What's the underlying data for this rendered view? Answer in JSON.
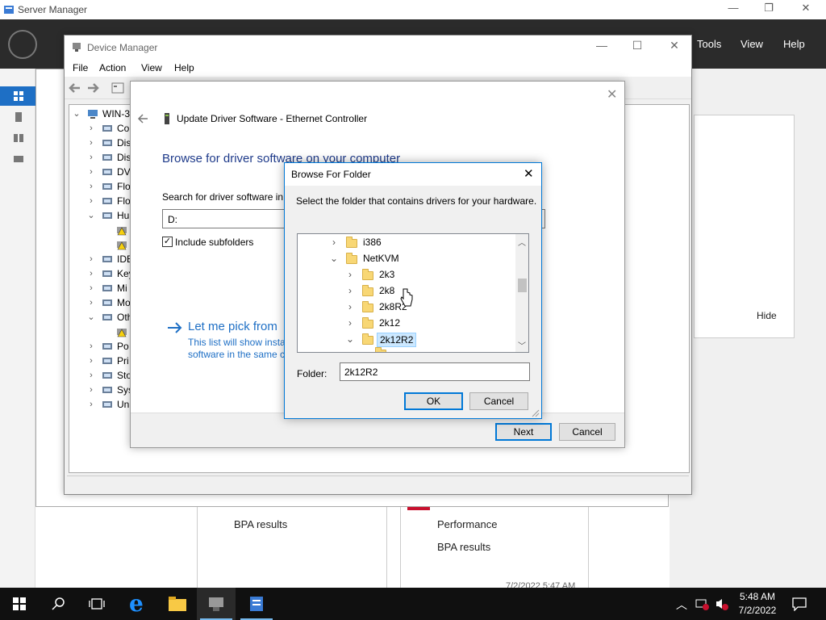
{
  "server_manager": {
    "title": "Server Manager",
    "menus": [
      "Tools",
      "View",
      "Help"
    ],
    "panel1": {
      "label": "BPA results"
    },
    "panel2": {
      "performance": "Performance",
      "bpa": "BPA results",
      "timestamp": "7/2/2022 5:47 AM"
    },
    "hide_label": "Hide"
  },
  "device_manager": {
    "title": "Device Manager",
    "menus": {
      "file": "File",
      "action": "Action",
      "view": "View",
      "help": "Help"
    },
    "root": "WIN-3",
    "tree": [
      {
        "label": "Co",
        "expander": ">"
      },
      {
        "label": "Dis",
        "expander": ">"
      },
      {
        "label": "Dis",
        "expander": ">"
      },
      {
        "label": "DV",
        "expander": ">"
      },
      {
        "label": "Flo",
        "expander": ">"
      },
      {
        "label": "Flo",
        "expander": ">"
      },
      {
        "label": "Hu",
        "expander": "v"
      },
      {
        "label": "",
        "expander": ""
      },
      {
        "label": "",
        "expander": ""
      },
      {
        "label": "IDE",
        "expander": ">"
      },
      {
        "label": "Key",
        "expander": ">"
      },
      {
        "label": "Mi",
        "expander": ">"
      },
      {
        "label": "Mo",
        "expander": ">"
      },
      {
        "label": "Oth",
        "expander": "v"
      },
      {
        "label": "",
        "expander": ""
      },
      {
        "label": "Po",
        "expander": ">"
      },
      {
        "label": "Pri",
        "expander": ">"
      },
      {
        "label": "Sto",
        "expander": ">"
      },
      {
        "label": "Sys",
        "expander": ">"
      },
      {
        "label": "Un",
        "expander": ">"
      }
    ]
  },
  "update_driver": {
    "title": "Update Driver Software - Ethernet Controller",
    "heading": "Browse for driver software on your computer",
    "search_label": "Search for driver software in t",
    "path_value": "D:",
    "include_subfolders": "Include subfolders",
    "pick_title": "Let me pick from",
    "pick_desc_1": "This list will show insta",
    "pick_desc_2": "software in the same c",
    "next": "Next",
    "cancel": "Cancel"
  },
  "browse_folder": {
    "title": "Browse For Folder",
    "instruction": "Select the folder that contains drivers for your hardware.",
    "tree": [
      {
        "label": "i386",
        "expander": ">",
        "indent": 0,
        "selected": false
      },
      {
        "label": "NetKVM",
        "expander": "v",
        "indent": 0,
        "selected": false
      },
      {
        "label": "2k3",
        "expander": ">",
        "indent": 1,
        "selected": false
      },
      {
        "label": "2k8",
        "expander": ">",
        "indent": 1,
        "selected": false
      },
      {
        "label": "2k8R2",
        "expander": ">",
        "indent": 1,
        "selected": false
      },
      {
        "label": "2k12",
        "expander": ">",
        "indent": 1,
        "selected": false
      },
      {
        "label": "2k12R2",
        "expander": "v",
        "indent": 1,
        "selected": true
      }
    ],
    "folder_label": "Folder:",
    "folder_value": "2k12R2",
    "ok": "OK",
    "cancel": "Cancel"
  },
  "taskbar": {
    "time": "5:48 AM",
    "date": "7/2/2022"
  }
}
